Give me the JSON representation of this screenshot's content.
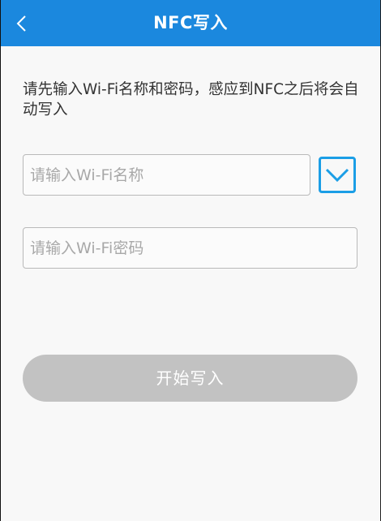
{
  "header": {
    "title": "NFC写入",
    "back_icon": "chevron-left-icon",
    "background_color": "#1b88de"
  },
  "instructions": "请先输入Wi-Fi名称和密码，感应到NFC之后将会自动写入",
  "ssid_field": {
    "placeholder": "请输入Wi-Fi名称",
    "value": ""
  },
  "ssid_dropdown": {
    "icon": "chevron-down-icon",
    "accent_color": "#1b9ee6"
  },
  "password_field": {
    "placeholder": "请输入Wi-Fi密码",
    "value": ""
  },
  "start_button": {
    "label": "开始写入",
    "state": "disabled",
    "color": "#c2c2c2"
  }
}
